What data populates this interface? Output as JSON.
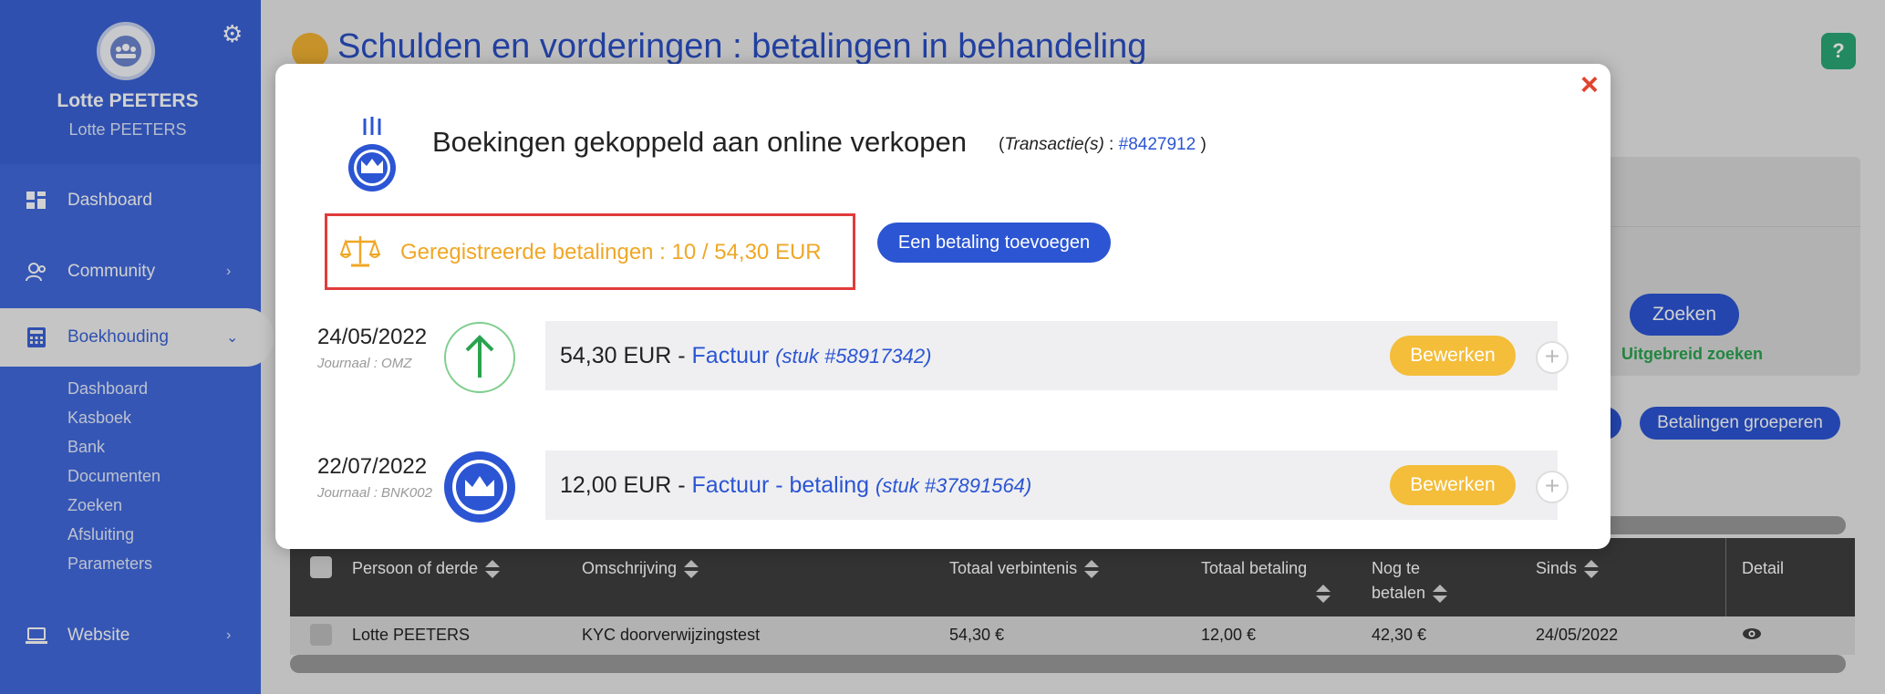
{
  "sidebar": {
    "user_name": "Lotte PEETERS",
    "user_sub": "Lotte PEETERS",
    "items": [
      {
        "label": "Dashboard"
      },
      {
        "label": "Community"
      },
      {
        "label": "Boekhouding"
      },
      {
        "label": "Website"
      }
    ],
    "sub_items": [
      "Dashboard",
      "Kasboek",
      "Bank",
      "Documenten",
      "Zoeken",
      "Afsluiting",
      "Parameters"
    ]
  },
  "main": {
    "title": "Schulden en vorderingen : betalingen in behandeling",
    "help_label": "?",
    "search_button": "Zoeken",
    "advanced_search": "Uitgebreid zoeken",
    "group_button": "Betalingen groeperen"
  },
  "table": {
    "headers": [
      "Persoon of derde",
      "Omschrijving",
      "Totaal verbintenis",
      "Totaal betaling",
      "Nog te betalen",
      "Sinds",
      "Detail"
    ],
    "header_nog_line1": "Nog te",
    "header_nog_line2": "betalen",
    "rows": [
      {
        "person": "Lotte PEETERS",
        "description": "KYC doorverwijzingstest",
        "total_commitment": "54,30 €",
        "total_payment": "12,00 €",
        "remaining": "42,30 €",
        "since": "24/05/2022"
      }
    ]
  },
  "modal": {
    "title": "Boekingen gekoppeld aan online verkopen",
    "trans_prefix": "(",
    "trans_label": "Transactie(s)",
    "trans_sep": " : ",
    "trans_ref": "#8427912",
    "trans_suffix": " )",
    "registered_payments": "Geregistreerde betalingen : 10 / 54,30 EUR",
    "add_payment_button": "Een betaling toevoegen",
    "close_label": "×",
    "payments": [
      {
        "date": "24/05/2022",
        "journal": "Journaal : OMZ",
        "amount": "54,30 EUR",
        "dash": " - ",
        "type": "Factuur",
        "piece": "(stuk #58917342)",
        "edit": "Bewerken"
      },
      {
        "date": "22/07/2022",
        "journal": "Journaal : BNK002",
        "amount": "12,00 EUR",
        "dash": " - ",
        "type": "Factuur - betaling",
        "piece": "(stuk #37891564)",
        "edit": "Bewerken"
      }
    ]
  },
  "colors": {
    "sidebar": "#4169dd",
    "primary": "#2b55d3",
    "warning": "#f4bd3a",
    "highlight_border": "#e03c3c",
    "success": "#2aa350"
  }
}
